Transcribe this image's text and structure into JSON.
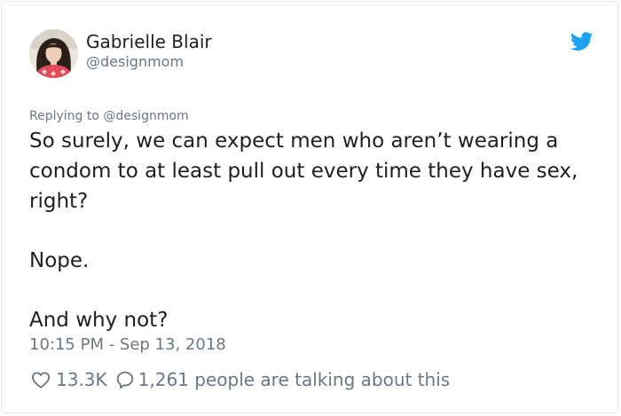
{
  "tweet": {
    "author_name": "Gabrielle Blair",
    "author_handle": "@designmom",
    "reply_prefix": "Replying to",
    "reply_target": "@designmom",
    "paragraphs": [
      "So surely, we can expect men who aren’t wearing a condom to at least pull out every time they have sex, right?",
      "Nope.",
      "And why not?"
    ],
    "timestamp": "10:15 PM - Sep 13, 2018",
    "likes": "13.3K",
    "talking": "1,261 people are talking about this"
  },
  "icons": {
    "brand": "twitter-bird-icon",
    "like": "heart-icon",
    "conversation": "speech-bubble-icon"
  },
  "colors": {
    "brand_blue": "#1da1f2",
    "text_primary": "#1c2022",
    "text_secondary": "#697882",
    "border": "#e1e8ed"
  }
}
